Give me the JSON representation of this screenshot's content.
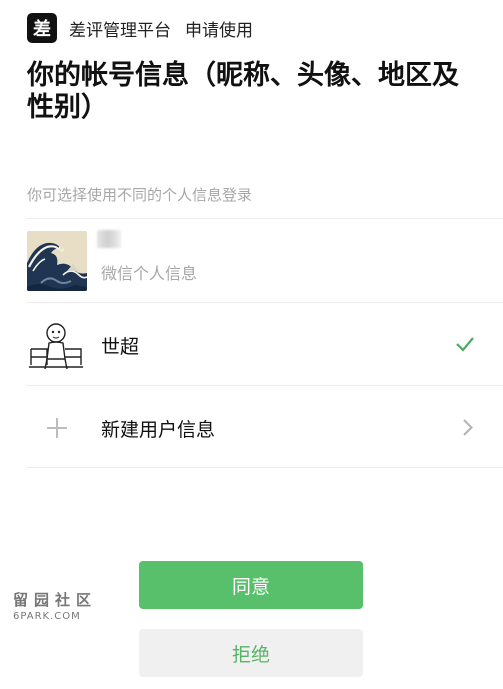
{
  "header": {
    "logo_text": "差",
    "app_name": "差评管理平台",
    "action": "申请使用"
  },
  "title": "你的帐号信息（昵称、头像、地区及性别）",
  "hint": "你可选择使用不同的个人信息登录",
  "accounts": [
    {
      "label": "",
      "sublabel": "微信个人信息",
      "avatar": "great-wave-avatar",
      "selected": false
    },
    {
      "label": "世超",
      "avatar": "meme-avatar",
      "selected": true
    },
    {
      "label": "新建用户信息",
      "icon": "plus-icon",
      "action": "chevron-right-icon"
    }
  ],
  "buttons": {
    "agree": "同意",
    "reject": "拒绝"
  },
  "watermark": {
    "top": "留园社区",
    "bottom": "6PARK.COM"
  },
  "colors": {
    "accent_green": "#58bf6a",
    "check_green": "#4eaa5e",
    "hint_gray": "#a7a7a7",
    "reject_bg": "#f0f0f0"
  }
}
